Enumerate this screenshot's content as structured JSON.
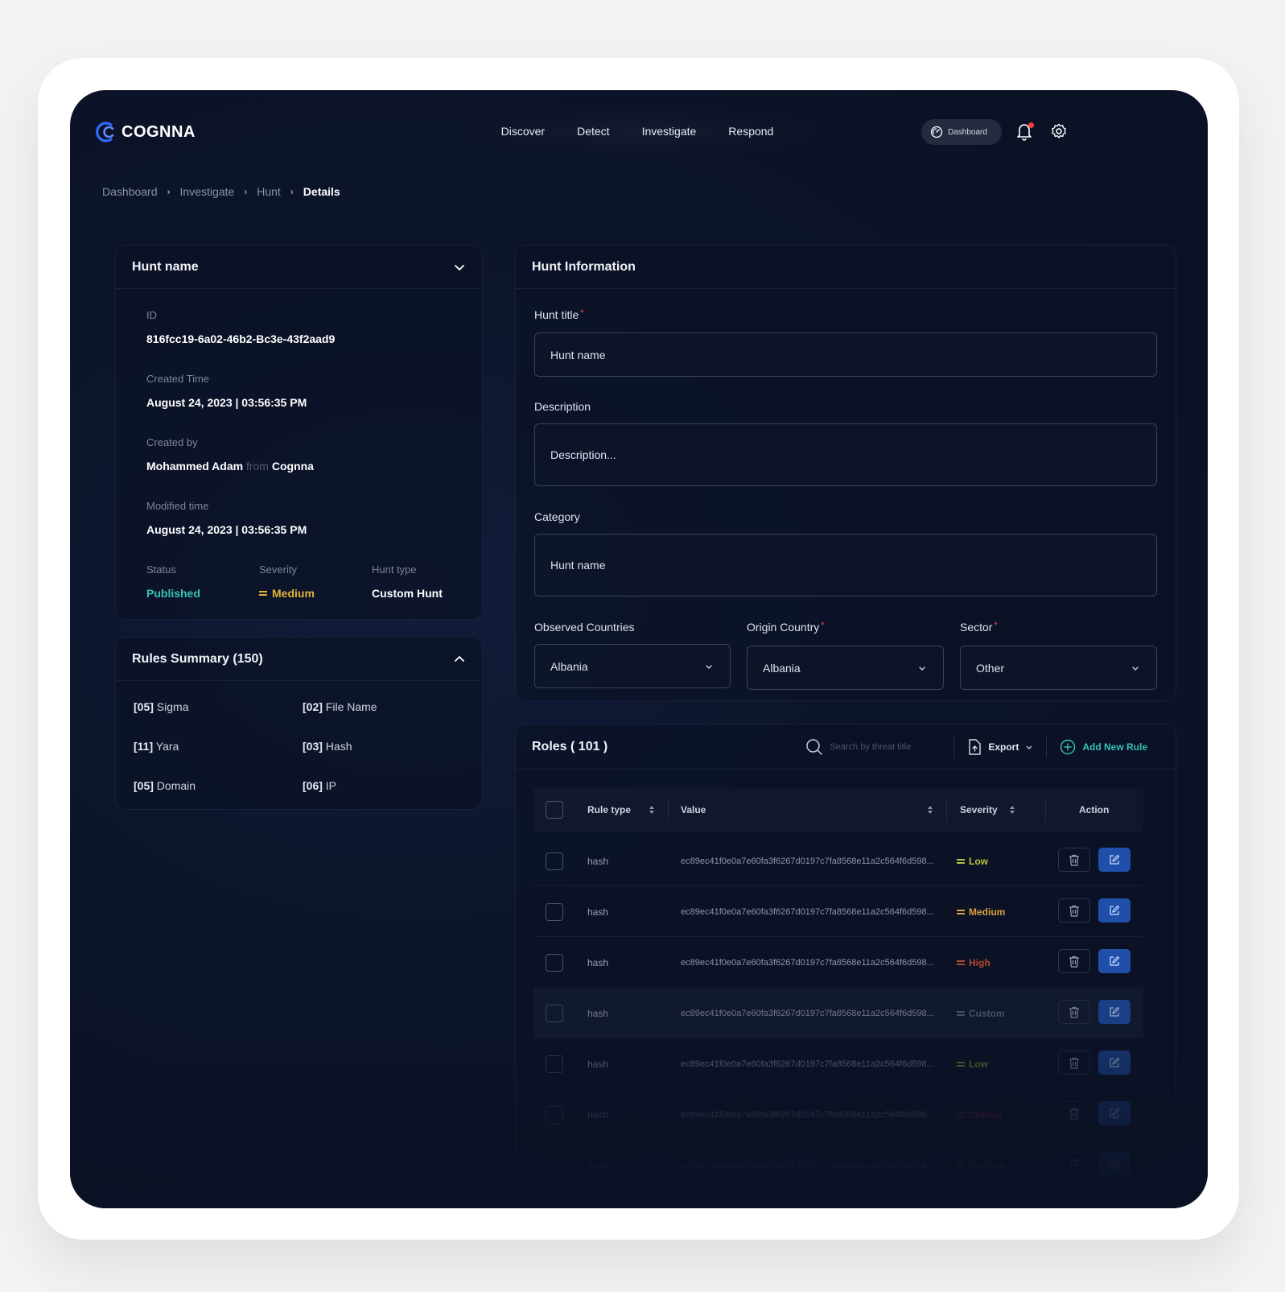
{
  "app": {
    "logo_text": "COGNNA",
    "nav": [
      "Discover",
      "Detect",
      "Investigate",
      "Respond"
    ],
    "dashboard_pill": "Dashboard"
  },
  "breadcrumb": [
    "Dashboard",
    "Investigate",
    "Hunt",
    "Details"
  ],
  "hunt_card": {
    "title": "Hunt name",
    "id_label": "ID",
    "id_value": "816fcc19-6a02-46b2-Bc3e-43f2aad9",
    "created_time_label": "Created Time",
    "created_time_value": "August 24, 2023 | 03:56:35 PM",
    "created_by_label": "Created by",
    "created_by_name": "Mohammed Adam",
    "created_by_from": "from",
    "created_by_org": "Cognna",
    "modified_label": "Modified time",
    "modified_value": "August 24, 2023 | 03:56:35 PM",
    "status_label": "Status",
    "status_value": "Published",
    "severity_label": "Severity",
    "severity_value": "Medium",
    "hunt_type_label": "Hunt type",
    "hunt_type_value": "Custom Hunt"
  },
  "rules_summary": {
    "title": "Rules Summary (150)",
    "items": [
      {
        "count": "[05]",
        "name": "Sigma"
      },
      {
        "count": "[02]",
        "name": "File Name"
      },
      {
        "count": "[11]",
        "name": "Yara"
      },
      {
        "count": "[03]",
        "name": "Hash"
      },
      {
        "count": "[05]",
        "name": "Domain"
      },
      {
        "count": "[06]",
        "name": "IP"
      }
    ]
  },
  "hunt_info": {
    "title": "Hunt Information",
    "hunt_title_label": "Hunt title",
    "hunt_title_value": "Hunt name",
    "description_label": "Description",
    "description_value": "Description...",
    "category_label": "Category",
    "category_value": "Hunt name",
    "observed_label": "Observed Countries",
    "observed_value": "Albania",
    "origin_label": "Origin Country",
    "origin_value": "Albania",
    "sector_label": "Sector",
    "sector_value": "Other",
    "required_mark": "*"
  },
  "roles": {
    "title": "Roles ( 101 )",
    "search_placeholder": "Search by threat title",
    "export_label": "Export",
    "add_label": "Add New Rule",
    "columns": {
      "rule_type": "Rule type",
      "value": "Value",
      "severity": "Severity",
      "action": "Action"
    },
    "rows": [
      {
        "type": "hash",
        "value": "ec89ec41f0e0a7e60fa3f6267d0197c7fa8568e11a2c564f6d598...",
        "severity": "Low",
        "color": "#b7c43a",
        "opacity": 1
      },
      {
        "type": "hash",
        "value": "ec89ec41f0e0a7e60fa3f6267d0197c7fa8568e11a2c564f6d598...",
        "severity": "Medium",
        "color": "#d7a23a",
        "opacity": 1
      },
      {
        "type": "hash",
        "value": "ec89ec41f0e0a7e60fa3f6267d0197c7fa8568e11a2c564f6d598...",
        "severity": "High",
        "color": "#b04a2e",
        "opacity": 1
      },
      {
        "type": "hash",
        "value": "ec89ec41f0e0a7e60fa3f6267d0197c7fa8568e11a2c564f6d598...",
        "severity": "Custom",
        "color": "#5b6478",
        "opacity": 0.75
      },
      {
        "type": "hash",
        "value": "ec89ec41f0e0a7e60fa3f6267d0197c7fa8568e11a2c564f6d598...",
        "severity": "Low",
        "color": "#8a9530",
        "opacity": 0.55
      },
      {
        "type": "hash",
        "value": "ec89ec41f0e0a7e60fa3f6267d0197c7fa8568e11a2c564f6d598...",
        "severity": "Critical",
        "color": "#8c2a2a",
        "opacity": 0.35
      },
      {
        "type": "hash",
        "value": "ec89ec41f0e0a7e60fa3f6267d0197c7fa8568e11a2c564f6d598...",
        "severity": "Medium",
        "color": "#8a6a28",
        "opacity": 0.2
      }
    ]
  },
  "colors": {
    "accent_blue": "#1f4fa8",
    "published": "#36c2b4",
    "medium": "#e2b23a",
    "add_new": "#35c0b7"
  }
}
